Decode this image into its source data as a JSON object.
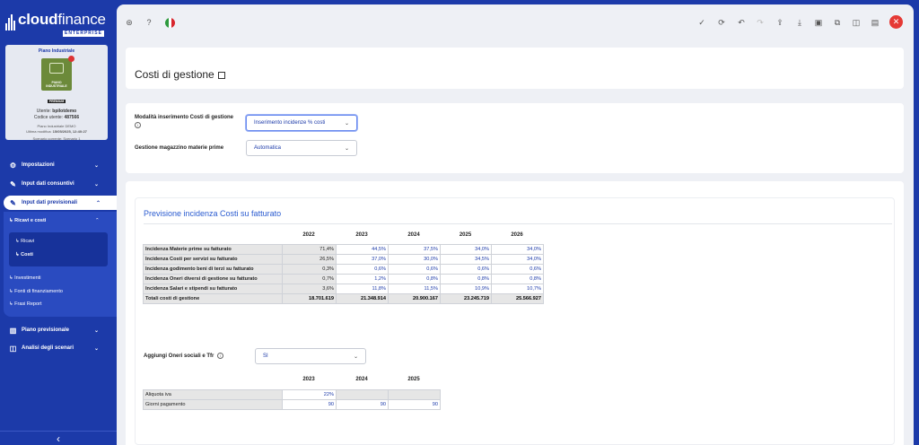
{
  "brand": {
    "name_bold": "cloud",
    "name_light": "finance",
    "edition": "ENTERPRISE"
  },
  "profile": {
    "plan_title": "Piano Industriale",
    "logo_lines": [
      "PIANO",
      "INDUSTRIALE"
    ],
    "logo_badge": "PREMIUM",
    "user_label": "Utente:",
    "user": "bpilotdemo",
    "code_label": "Codice utente:",
    "code": "487566",
    "plan_name": "Piano Industriale DEMO",
    "last_modified_label": "Ultima modifica:",
    "last_modified": "15/05/2025, 12:40:27",
    "scenario": "Scenario corrente: Scenario 1"
  },
  "nav": {
    "settings": "Impostazioni",
    "actual": "Input dati consuntivi",
    "forecast": "Input dati previsionali",
    "revenues_costs": "Ricavi e costi",
    "revenues": "Ricavi",
    "costs": "Costi",
    "investments": "Investimenti",
    "financing": "Fonti di finanziamento",
    "report": "Frasi Report",
    "plan": "Piano previsionale",
    "scenarios": "Analisi degli scenari"
  },
  "page": {
    "title": "Costi di gestione",
    "mode_label": "Modalità inserimento Costi di gestione",
    "mode_value": "Inserimento incidenze % costi",
    "warehouse_label": "Gestione magazzino materie prime",
    "warehouse_value": "Automatica",
    "section_title": "Previsione incidenza Costi su fatturato"
  },
  "cost_table": {
    "years": [
      "2022",
      "2023",
      "2024",
      "2025",
      "2026"
    ],
    "rows": [
      {
        "label": "Incidenza Materie prime su fatturato",
        "values": [
          "71,4%",
          "44,5%",
          "37,5%",
          "34,0%",
          "34,0%"
        ]
      },
      {
        "label": "Incidenza Costi per servizi su fatturato",
        "values": [
          "26,5%",
          "37,0%",
          "30,0%",
          "34,5%",
          "34,0%"
        ]
      },
      {
        "label": "Incidenza godimento beni di terzi su fatturato",
        "values": [
          "0,3%",
          "0,6%",
          "0,6%",
          "0,6%",
          "0,6%"
        ]
      },
      {
        "label": "Incidenza Oneri diversi di gestione su fatturato",
        "values": [
          "0,7%",
          "1,2%",
          "0,8%",
          "0,8%",
          "0,8%"
        ]
      },
      {
        "label": "Incidenza Salari e stipendi su fatturato",
        "values": [
          "3,6%",
          "11,8%",
          "11,5%",
          "10,9%",
          "10,7%"
        ]
      }
    ],
    "total": {
      "label": "Totali costi di gestione",
      "values": [
        "18.701.619",
        "21.348.914",
        "20.900.167",
        "23.245.719",
        "25.566.927"
      ]
    }
  },
  "social": {
    "label": "Aggiungi Oneri sociali e Tfr",
    "value": "SI"
  },
  "vat_table": {
    "years": [
      "2023",
      "2024",
      "2025"
    ],
    "rows": [
      {
        "label": "Aliquota iva",
        "values": [
          "22%",
          "",
          ""
        ]
      },
      {
        "label": "Giorni pagamento",
        "values": [
          "90",
          "90",
          "90"
        ]
      }
    ]
  },
  "colors": {
    "brand": "#1c3aa9",
    "accent": "#2a5bd0",
    "close": "#e53935"
  }
}
